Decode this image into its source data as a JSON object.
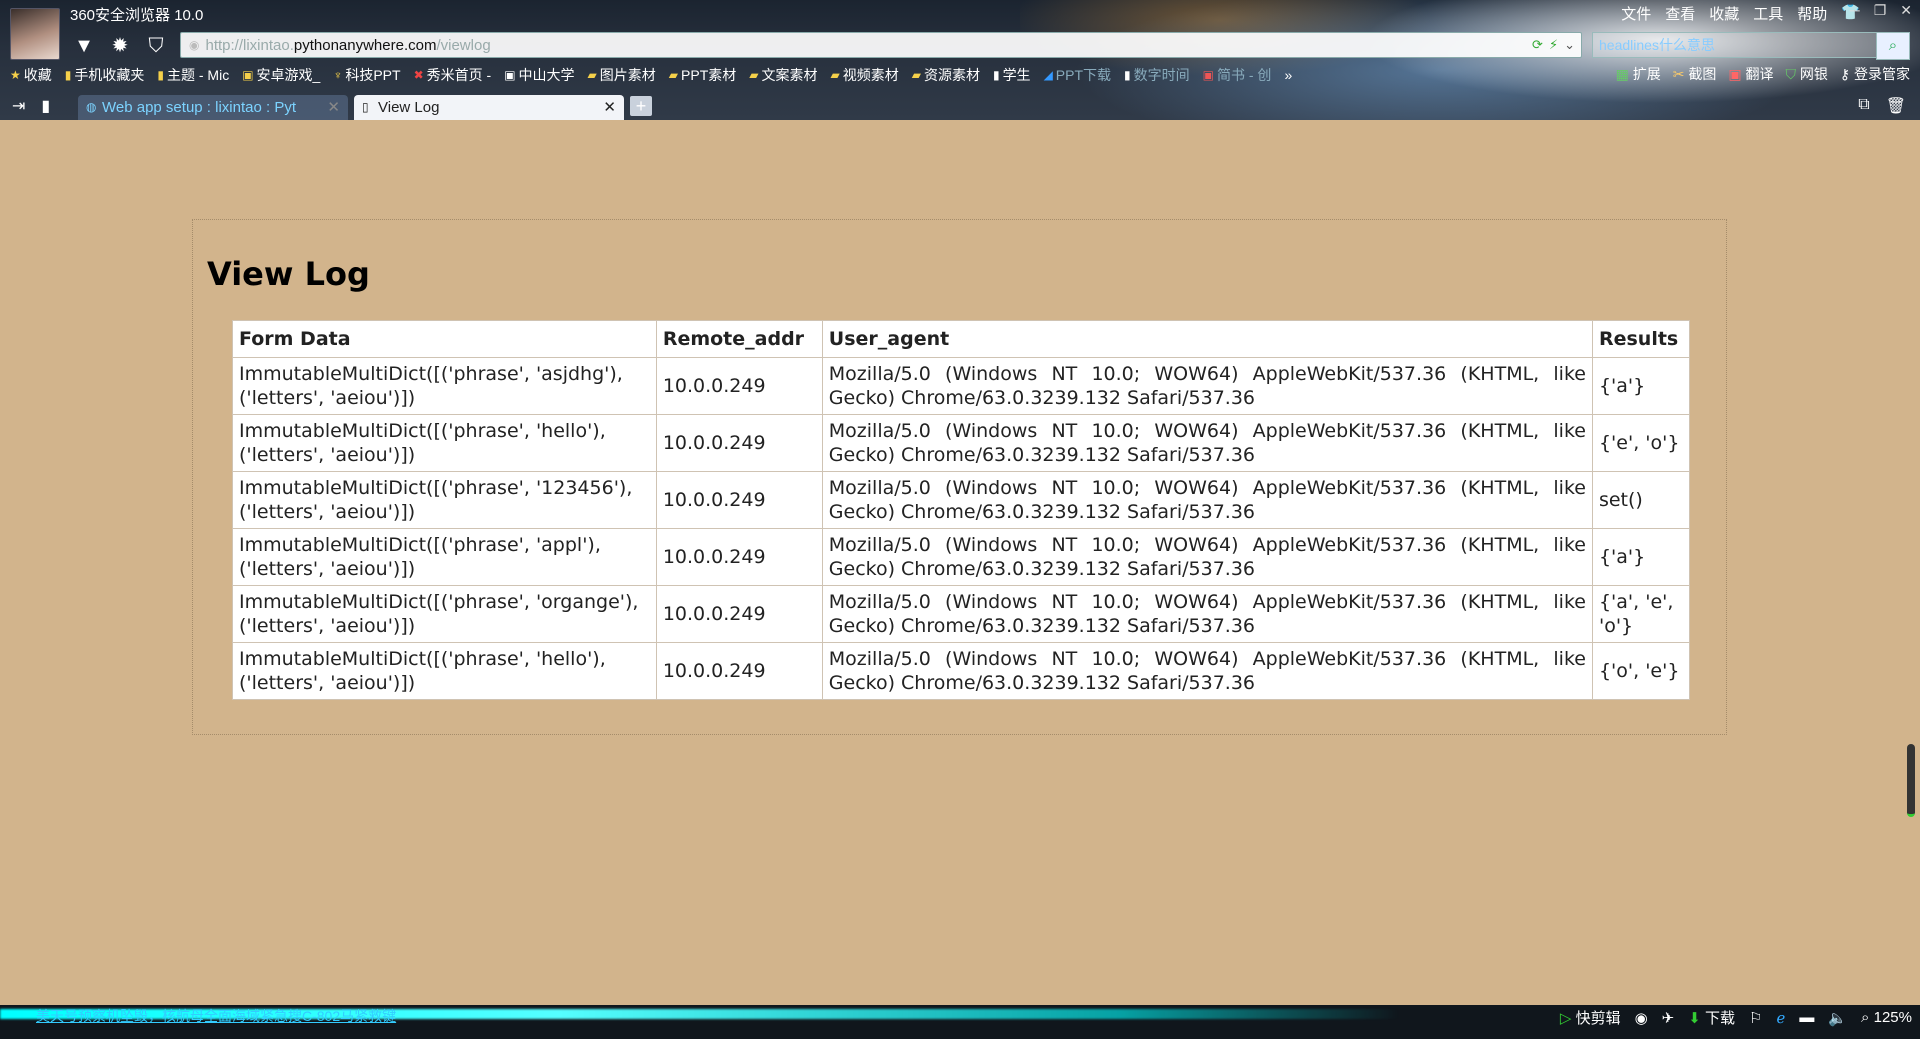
{
  "browser": {
    "app_title": "360安全浏览器 10.0",
    "menu": [
      "文件",
      "查看",
      "收藏",
      "工具",
      "帮助"
    ],
    "address": {
      "prefix": "http://lixintao.",
      "host": "pythonanywhere.com",
      "path": "/viewlog"
    },
    "search": {
      "value": "headlines什么意思"
    },
    "bookmarks": [
      "收藏",
      "手机收藏夹",
      "主题 - Mic",
      "安卓游戏_",
      "科技PPT",
      "秀米首页 -",
      "中山大学",
      "图片素材",
      "PPT素材",
      "文案素材",
      "视频素材",
      "资源素材",
      "学生",
      "PPT下载",
      "数字时间",
      "简书 - 创"
    ],
    "bookmarks_right": [
      "扩展",
      "截图",
      "翻译",
      "网银",
      "登录管家"
    ],
    "tabs": [
      {
        "label": "Web app setup : lixintao : Pyt",
        "active": false
      },
      {
        "label": "View Log",
        "active": true
      }
    ]
  },
  "page": {
    "title": "View Log",
    "table": {
      "headers": [
        "Form Data",
        "Remote_addr",
        "User_agent",
        "Results"
      ],
      "rows": [
        [
          "ImmutableMultiDict([('phrase', 'asjdhg'), ('letters', 'aeiou')])",
          "10.0.0.249",
          "Mozilla/5.0 (Windows NT 10.0; WOW64) AppleWebKit/537.36 (KHTML, like Gecko) Chrome/63.0.3239.132 Safari/537.36",
          "{'a'}"
        ],
        [
          "ImmutableMultiDict([('phrase', 'hello'), ('letters', 'aeiou')])",
          "10.0.0.249",
          "Mozilla/5.0 (Windows NT 10.0; WOW64) AppleWebKit/537.36 (KHTML, like Gecko) Chrome/63.0.3239.132 Safari/537.36",
          "{'e', 'o'}"
        ],
        [
          "ImmutableMultiDict([('phrase', '123456'), ('letters', 'aeiou')])",
          "10.0.0.249",
          "Mozilla/5.0 (Windows NT 10.0; WOW64) AppleWebKit/537.36 (KHTML, like Gecko) Chrome/63.0.3239.132 Safari/537.36",
          "set()"
        ],
        [
          "ImmutableMultiDict([('phrase', 'appl'), ('letters', 'aeiou')])",
          "10.0.0.249",
          "Mozilla/5.0 (Windows NT 10.0; WOW64) AppleWebKit/537.36 (KHTML, like Gecko) Chrome/63.0.3239.132 Safari/537.36",
          "{'a'}"
        ],
        [
          "ImmutableMultiDict([('phrase', 'organge'), ('letters', 'aeiou')])",
          "10.0.0.249",
          "Mozilla/5.0 (Windows NT 10.0; WOW64) AppleWebKit/537.36 (KHTML, like Gecko) Chrome/63.0.3239.132 Safari/537.36",
          "{'a', 'e', 'o'}"
        ],
        [
          "ImmutableMultiDict([('phrase', 'hello'), ('letters', 'aeiou')])",
          "10.0.0.249",
          "Mozilla/5.0 (Windows NT 10.0; WOW64) AppleWebKit/537.36 (KHTML, like Gecko) Chrome/63.0.3239.132 Safari/537.36",
          "{'o', 'e'}"
        ]
      ]
    }
  },
  "statusbar": {
    "message": "美天号预察机坠毁，核航母全面海域紧急搜C-802马紧救键",
    "items": [
      "快剪辑",
      "下载",
      "125%"
    ]
  },
  "colors": {
    "page_background": "#d2b48c",
    "table_background": "#ffffff"
  }
}
